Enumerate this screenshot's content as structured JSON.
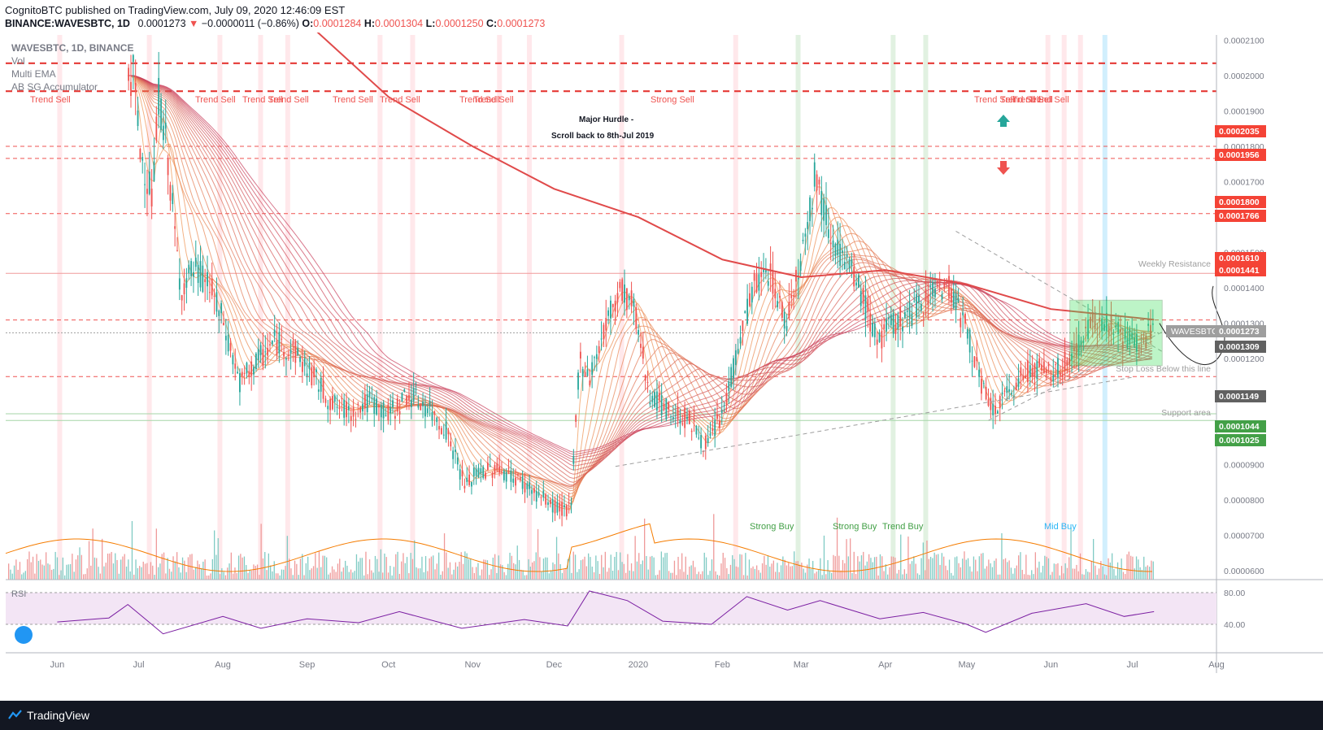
{
  "header": {
    "publisher_line": "CognitoBTC published on TradingView.com, July 09, 2020 12:46:09 EST",
    "symbol": "BINANCE:WAVESBTC, 1D",
    "last": "0.0001273",
    "change": "−0.0000011 (−0.86%)",
    "ohlc": {
      "o_label": "O:",
      "o": "0.0001284",
      "h_label": "H:",
      "h": "0.0001304",
      "l_label": "L:",
      "l": "0.0001250",
      "c_label": "C:",
      "c": "0.0001273"
    }
  },
  "legend": {
    "title": "WAVESBTC, 1D, BINANCE",
    "items": [
      "Vol",
      "Multi EMA",
      "AB SG Accumulator"
    ]
  },
  "rsi_label": "RSI",
  "footer": {
    "brand": "TradingView"
  },
  "colors": {
    "up": "#26a69a",
    "down": "#ef5350",
    "ema200": "#e04a4a",
    "rsi": "#7b1fa2",
    "rsi_bg": "#f3e5f5",
    "green_box": "#44e060",
    "accent_teal": "#26a69a"
  },
  "annotations": {
    "trend_sell": [
      "Trend Sell",
      "Trend Sell",
      "Trend Sell",
      "Trend Sell",
      "Trend Sell",
      "Trend Sell",
      "Trend Sell",
      "Trend Sell",
      "Trend Sell",
      "Trend Sell",
      "Trend Sell",
      "Trend Sell"
    ],
    "strong_sell": "Strong Sell",
    "major_hurdle": "Major Hurdle -",
    "scroll_back": "Scroll back to 8th-Jul 2019",
    "strong_buy": [
      "Strong Buy",
      "Strong Buy"
    ],
    "trend_buy": "Trend Buy",
    "mid_buy": "Mid Buy",
    "weekly_resistance": "Weekly Resistance",
    "stop_loss": "Stop Loss  Below this line",
    "support_area": "Support area",
    "wavesbtc_tag": "WAVESBTC"
  },
  "price_axis": {
    "ticks": [
      "0.0002100",
      "0.0002000",
      "0.0001900",
      "0.0001800",
      "0.0001700",
      "0.0001600",
      "0.0001500",
      "0.0001400",
      "0.0001300",
      "0.0001200",
      "0.0001100",
      "0.0001000",
      "0.0000900",
      "0.0000800",
      "0.0000700",
      "0.0000600"
    ],
    "red_badges": [
      "0.0002035",
      "0.0001956",
      "0.0001800",
      "0.0001766",
      "0.0001610",
      "0.0001441"
    ],
    "gray_badges": [
      "0.0001273",
      "0.0001309",
      "0.0001149"
    ],
    "green_badges": [
      "0.0001044",
      "0.0001025"
    ]
  },
  "rsi_axis": {
    "ticks": [
      "80.00",
      "40.00"
    ]
  },
  "time_axis": [
    "Jun",
    "Jul",
    "Aug",
    "Sep",
    "Oct",
    "Nov",
    "Dec",
    "2020",
    "Feb",
    "Mar",
    "Apr",
    "May",
    "Jun",
    "Jul",
    "Aug"
  ],
  "chart_data": {
    "type": "candlestick",
    "title": "WAVESBTC, 1D, BINANCE",
    "ylim": [
      5.75e-05,
      0.0002115
    ],
    "horizontal_levels": [
      0.0002035,
      0.0001956,
      0.00018,
      0.0001766,
      0.000161,
      0.0001441,
      0.0001309,
      0.0001273,
      0.0001149,
      0.0001044,
      0.0001025
    ],
    "close_series": [
      {
        "date": "2019-06-29",
        "close": 0.0002
      },
      {
        "date": "2019-07-01",
        "close": 0.00018
      },
      {
        "date": "2019-07-06",
        "close": 0.000165
      },
      {
        "date": "2019-07-08",
        "close": 0.000195
      },
      {
        "date": "2019-07-11",
        "close": 0.00018
      },
      {
        "date": "2019-07-16",
        "close": 0.00014
      },
      {
        "date": "2019-07-21",
        "close": 0.000145
      },
      {
        "date": "2019-07-26",
        "close": 0.000142
      },
      {
        "date": "2019-08-01",
        "close": 0.00013
      },
      {
        "date": "2019-08-07",
        "close": 0.000113
      },
      {
        "date": "2019-08-12",
        "close": 0.000118
      },
      {
        "date": "2019-08-20",
        "close": 0.000125
      },
      {
        "date": "2019-08-27",
        "close": 0.000122
      },
      {
        "date": "2019-09-03",
        "close": 0.000115
      },
      {
        "date": "2019-09-10",
        "close": 0.000107
      },
      {
        "date": "2019-09-17",
        "close": 0.000105
      },
      {
        "date": "2019-09-24",
        "close": 0.000108
      },
      {
        "date": "2019-10-01",
        "close": 0.000104
      },
      {
        "date": "2019-10-08",
        "close": 0.00011
      },
      {
        "date": "2019-10-15",
        "close": 0.000106
      },
      {
        "date": "2019-10-22",
        "close": 0.0001
      },
      {
        "date": "2019-10-29",
        "close": 8.4e-05
      },
      {
        "date": "2019-11-03",
        "close": 8.8e-05
      },
      {
        "date": "2019-11-10",
        "close": 8.9e-05
      },
      {
        "date": "2019-11-17",
        "close": 8.6e-05
      },
      {
        "date": "2019-11-24",
        "close": 8.2e-05
      },
      {
        "date": "2019-12-01",
        "close": 7.8e-05
      },
      {
        "date": "2019-12-07",
        "close": 7.7e-05
      },
      {
        "date": "2019-12-10",
        "close": 0.00012
      },
      {
        "date": "2019-12-14",
        "close": 0.000115
      },
      {
        "date": "2019-12-20",
        "close": 0.00013
      },
      {
        "date": "2019-12-25",
        "close": 0.00014
      },
      {
        "date": "2019-12-30",
        "close": 0.000135
      },
      {
        "date": "2020-01-05",
        "close": 0.00011
      },
      {
        "date": "2020-01-12",
        "close": 0.000105
      },
      {
        "date": "2020-01-19",
        "close": 0.000103
      },
      {
        "date": "2020-01-26",
        "close": 9.5e-05
      },
      {
        "date": "2020-02-01",
        "close": 0.000105
      },
      {
        "date": "2020-02-07",
        "close": 0.000125
      },
      {
        "date": "2020-02-12",
        "close": 0.00014
      },
      {
        "date": "2020-02-18",
        "close": 0.000145
      },
      {
        "date": "2020-02-24",
        "close": 0.00013
      },
      {
        "date": "2020-03-01",
        "close": 0.00015
      },
      {
        "date": "2020-03-06",
        "close": 0.000172
      },
      {
        "date": "2020-03-10",
        "close": 0.00016
      },
      {
        "date": "2020-03-15",
        "close": 0.00015
      },
      {
        "date": "2020-03-22",
        "close": 0.00014
      },
      {
        "date": "2020-03-29",
        "close": 0.000125
      },
      {
        "date": "2020-04-04",
        "close": 0.00013
      },
      {
        "date": "2020-04-11",
        "close": 0.000133
      },
      {
        "date": "2020-04-18",
        "close": 0.00014
      },
      {
        "date": "2020-04-25",
        "close": 0.00014
      },
      {
        "date": "2020-05-02",
        "close": 0.000125
      },
      {
        "date": "2020-05-07",
        "close": 0.00011
      },
      {
        "date": "2020-05-11",
        "close": 0.000105
      },
      {
        "date": "2020-05-18",
        "close": 0.000112
      },
      {
        "date": "2020-05-25",
        "close": 0.000118
      },
      {
        "date": "2020-06-01",
        "close": 0.000115
      },
      {
        "date": "2020-06-08",
        "close": 0.00012
      },
      {
        "date": "2020-06-14",
        "close": 0.000128
      },
      {
        "date": "2020-06-20",
        "close": 0.000132
      },
      {
        "date": "2020-06-27",
        "close": 0.000126
      },
      {
        "date": "2020-07-03",
        "close": 0.000125
      },
      {
        "date": "2020-07-09",
        "close": 0.0001273
      }
    ],
    "ema200_series": [
      {
        "date": "2019-09-01",
        "value": 0.000215
      },
      {
        "date": "2019-10-01",
        "value": 0.000194
      },
      {
        "date": "2019-11-01",
        "value": 0.00018
      },
      {
        "date": "2019-12-01",
        "value": 0.000168
      },
      {
        "date": "2020-01-01",
        "value": 0.00016
      },
      {
        "date": "2020-02-01",
        "value": 0.000148
      },
      {
        "date": "2020-03-01",
        "value": 0.000143
      },
      {
        "date": "2020-04-01",
        "value": 0.000145
      },
      {
        "date": "2020-05-01",
        "value": 0.000141
      },
      {
        "date": "2020-06-01",
        "value": 0.000134
      },
      {
        "date": "2020-07-09",
        "value": 0.000131
      }
    ],
    "rsi_series": [
      {
        "date": "2019-06-01",
        "value": 43
      },
      {
        "date": "2019-06-20",
        "value": 48
      },
      {
        "date": "2019-06-27",
        "value": 65
      },
      {
        "date": "2019-07-10",
        "value": 28
      },
      {
        "date": "2019-08-01",
        "value": 50
      },
      {
        "date": "2019-08-15",
        "value": 35
      },
      {
        "date": "2019-09-01",
        "value": 47
      },
      {
        "date": "2019-09-20",
        "value": 42
      },
      {
        "date": "2019-10-05",
        "value": 56
      },
      {
        "date": "2019-10-28",
        "value": 35
      },
      {
        "date": "2019-11-20",
        "value": 46
      },
      {
        "date": "2019-12-06",
        "value": 38
      },
      {
        "date": "2019-12-14",
        "value": 82
      },
      {
        "date": "2019-12-28",
        "value": 70
      },
      {
        "date": "2020-01-10",
        "value": 44
      },
      {
        "date": "2020-01-28",
        "value": 40
      },
      {
        "date": "2020-02-10",
        "value": 75
      },
      {
        "date": "2020-02-25",
        "value": 58
      },
      {
        "date": "2020-03-08",
        "value": 70
      },
      {
        "date": "2020-03-30",
        "value": 47
      },
      {
        "date": "2020-04-15",
        "value": 55
      },
      {
        "date": "2020-05-01",
        "value": 40
      },
      {
        "date": "2020-05-08",
        "value": 30
      },
      {
        "date": "2020-05-25",
        "value": 54
      },
      {
        "date": "2020-06-14",
        "value": 66
      },
      {
        "date": "2020-06-28",
        "value": 50
      },
      {
        "date": "2020-07-09",
        "value": 56
      }
    ]
  }
}
